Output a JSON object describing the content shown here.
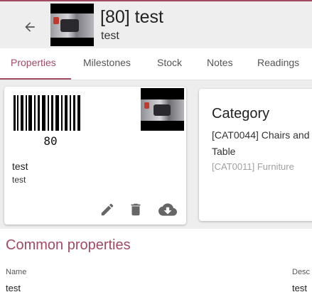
{
  "header": {
    "title": "[80] test",
    "subtitle": "test"
  },
  "tabs": [
    {
      "label": "Properties",
      "active": true
    },
    {
      "label": "Milestones",
      "active": false
    },
    {
      "label": "Stock",
      "active": false
    },
    {
      "label": "Notes",
      "active": false
    },
    {
      "label": "Readings",
      "active": false
    }
  ],
  "card": {
    "barcode_value": "80",
    "name": "test",
    "description": "test",
    "actions": [
      "edit-icon",
      "delete-icon",
      "download-icon"
    ]
  },
  "category": {
    "heading": "Category",
    "value": "[CAT0044] Chairs and Table",
    "parent": "[CAT0011] Furniture"
  },
  "common_properties": {
    "title": "Common properties",
    "columns": [
      {
        "label": "Name",
        "value": "test"
      },
      {
        "label": "Desc",
        "value": "test"
      }
    ]
  },
  "colors": {
    "accent": "#a24a63"
  }
}
